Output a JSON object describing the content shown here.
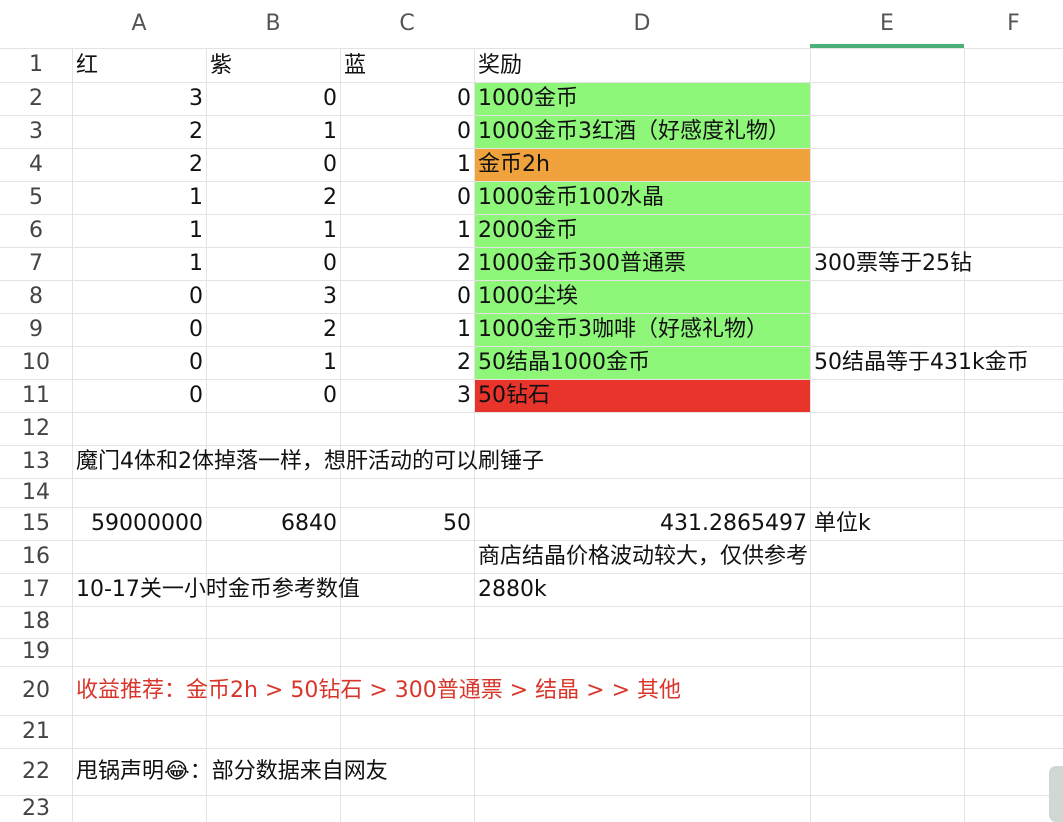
{
  "columns": [
    "A",
    "B",
    "C",
    "D",
    "E",
    "F"
  ],
  "rows": [
    "1",
    "2",
    "3",
    "4",
    "5",
    "6",
    "7",
    "8",
    "9",
    "10",
    "11",
    "12",
    "13",
    "14",
    "15",
    "16",
    "17",
    "18",
    "19",
    "20",
    "21",
    "22",
    "23"
  ],
  "cells": {
    "A1": "红",
    "B1": "紫",
    "C1": "蓝",
    "D1": "奖励",
    "A2": "3",
    "B2": "0",
    "C2": "0",
    "D2": "1000金币",
    "A3": "2",
    "B3": "1",
    "C3": "0",
    "D3": "1000金币3红酒（好感度礼物）",
    "A4": "2",
    "B4": "0",
    "C4": "1",
    "D4": "金币2h",
    "A5": "1",
    "B5": "2",
    "C5": "0",
    "D5": "1000金币100水晶",
    "A6": "1",
    "B6": "1",
    "C6": "1",
    "D6": "2000金币",
    "A7": "1",
    "B7": "0",
    "C7": "2",
    "D7": "1000金币300普通票",
    "E7": "300票等于25钻",
    "A8": "0",
    "B8": "3",
    "C8": "0",
    "D8": "1000尘埃",
    "A9": "0",
    "B9": "2",
    "C9": "1",
    "D9": "1000金币3咖啡（好感礼物）",
    "A10": "0",
    "B10": "1",
    "C10": "2",
    "D10": "50结晶1000金币",
    "E10": "50结晶等于431k金币",
    "A11": "0",
    "B11": "0",
    "C11": "3",
    "D11": "50钻石",
    "A13": "魔门4体和2体掉落一样，想肝活动的可以刷锤子",
    "A15": "59000000",
    "B15": "6840",
    "C15": "50",
    "D15": "431.2865497",
    "E15": "单位k",
    "D16": "商店结晶价格波动较大，仅供参考",
    "A17": "10-17关一小时金币参考数值",
    "D17": "2880k",
    "A20": "收益推荐：金币2h > 50钻石 > 300普通票 > 结晶 > > 其他",
    "A22": "甩锅声明😂：部分数据来自网友"
  },
  "colors": {
    "green_fill": "#8ef77a",
    "orange_fill": "#f0a33d",
    "red_fill": "#e8342a",
    "red_text": "#d9362b",
    "selected_column_accent": "#4caf78"
  },
  "selected_column": "E"
}
